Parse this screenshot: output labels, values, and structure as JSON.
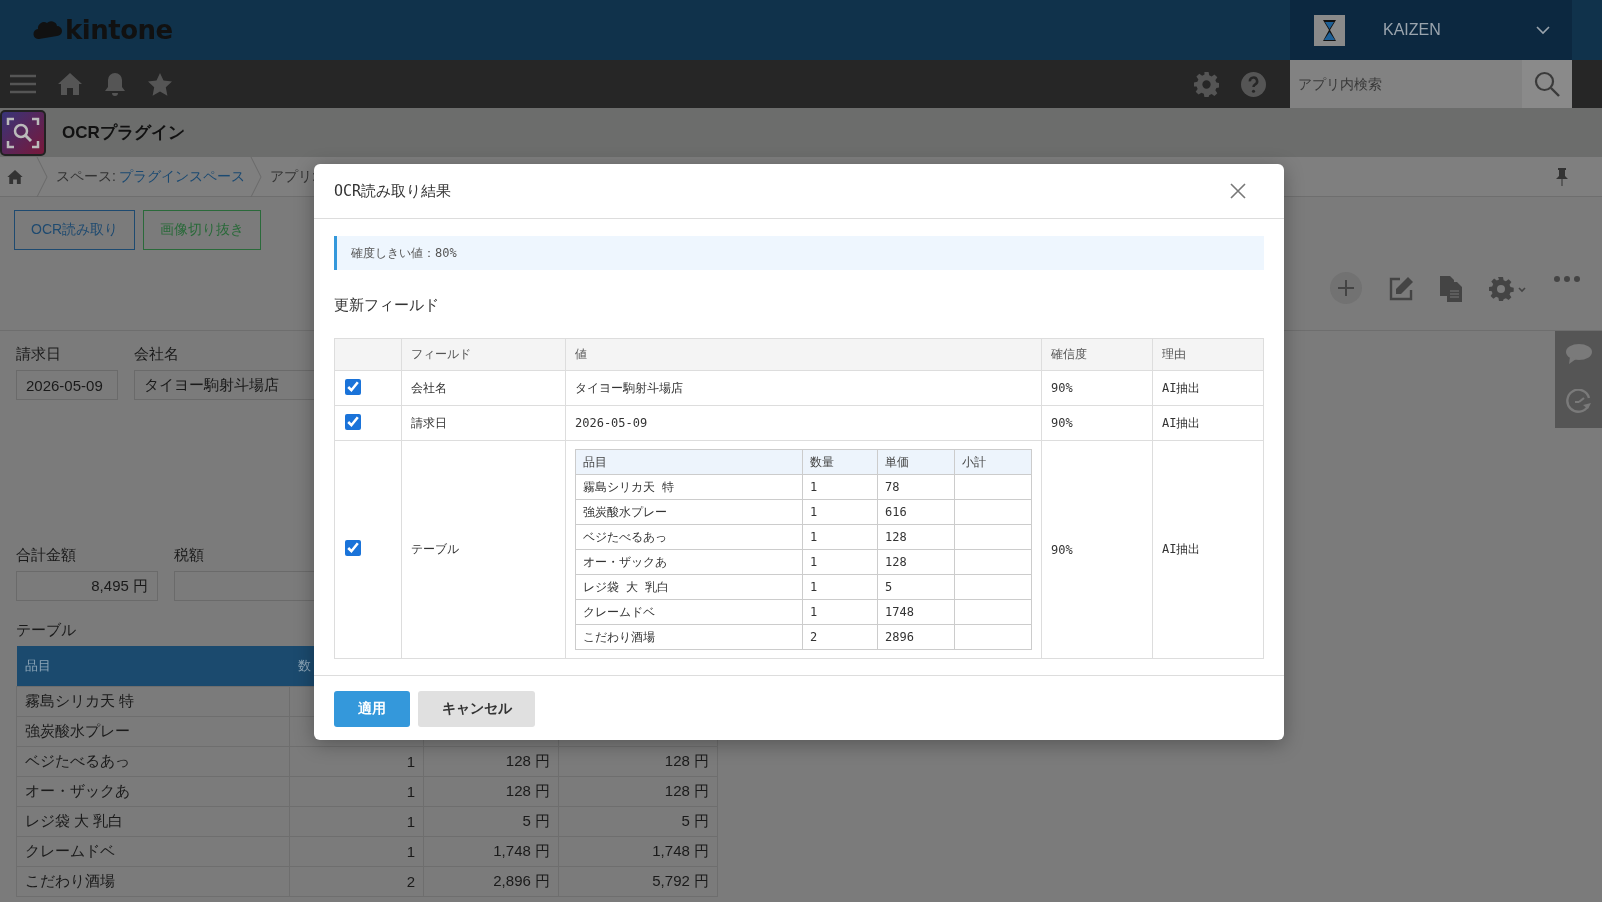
{
  "header": {
    "logo": "kintone",
    "user": {
      "name": "KAIZEN"
    }
  },
  "search": {
    "placeholder": "アプリ内検索"
  },
  "app": {
    "title": "OCRプラグイン"
  },
  "breadcrumb": [
    {
      "label": "スペース:",
      "link": "プラグインスペース"
    },
    {
      "label": "アプリ:"
    }
  ],
  "toolbar_buttons": [
    {
      "label": "OCR読み取り",
      "kind": "primary"
    },
    {
      "label": "画像切り抜き",
      "kind": "success"
    }
  ],
  "field_rows": [
    [
      {
        "label": "請求日",
        "value": "2026-05-09",
        "kind": "text"
      },
      {
        "label": "会社名",
        "value": "タイヨー駒射斗場店",
        "kind": "text"
      }
    ],
    [
      {
        "label": "合計金額",
        "value": "8,495 円",
        "kind": "number"
      },
      {
        "label": "税額",
        "kind": "number"
      }
    ]
  ],
  "subtable": {
    "label": "テーブル",
    "columns": [
      "品目",
      "数"
    ],
    "rows": [
      {
        "item": "霧島シリカ天 特"
      },
      {
        "item": "強炭酸水プレー"
      },
      {
        "item": "ベジたべるあっ",
        "qty": "1",
        "price": "128 円",
        "subtotal": "128 円"
      },
      {
        "item": "オー・ザックあ",
        "qty": "1",
        "price": "128 円",
        "subtotal": "128 円"
      },
      {
        "item": "レジ袋 大 乳白",
        "qty": "1",
        "price": "5 円",
        "subtotal": "5 円"
      },
      {
        "item": "クレームドベ",
        "qty": "1",
        "price": "1,748 円",
        "subtotal": "1,748 円"
      },
      {
        "item": "こだわり酒場",
        "qty": "2",
        "price": "2,896 円",
        "subtotal": "5,792 円"
      }
    ]
  },
  "dialog": {
    "title": "OCR読み取り結果",
    "notice": "確度しきい値：80%",
    "section_title": "更新フィールド",
    "columns": [
      "フィールド",
      "値",
      "確信度",
      "理由"
    ],
    "rows": [
      {
        "checked": true,
        "field": "会社名",
        "kind": "text",
        "value": "タイヨー駒射斗場店",
        "confidence": "90%",
        "reason": "AI抽出"
      },
      {
        "checked": true,
        "field": "請求日",
        "kind": "text",
        "value": "2026-05-09",
        "confidence": "90%",
        "reason": "AI抽出"
      },
      {
        "checked": true,
        "field": "テーブル",
        "kind": "table",
        "table": {
          "columns": [
            "品目",
            "数量",
            "単価",
            "小計"
          ],
          "rows": [
            [
              "霧島シリカ天 特",
              "1",
              "78"
            ],
            [
              "強炭酸水プレー",
              "1",
              "616"
            ],
            [
              "ベジたべるあっ",
              "1",
              "128"
            ],
            [
              "オー・ザックあ",
              "1",
              "128"
            ],
            [
              "レジ袋 大 乳白",
              "1",
              "5"
            ],
            [
              "クレームドベ",
              "1",
              "1748"
            ],
            [
              "こだわり酒場",
              "2",
              "2896"
            ]
          ]
        },
        "confidence": "90%",
        "reason": "AI抽出"
      }
    ],
    "buttons": [
      {
        "label": "適用",
        "kind": "primary"
      },
      {
        "label": "キャンセル",
        "kind": "secondary"
      }
    ]
  }
}
